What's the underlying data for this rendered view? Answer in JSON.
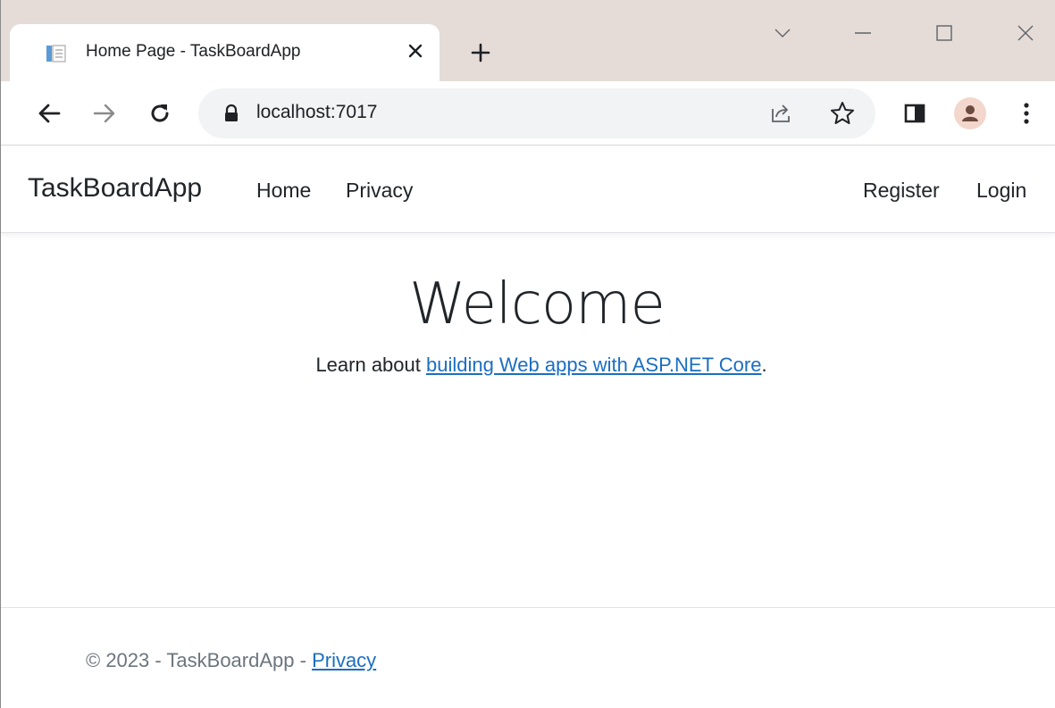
{
  "browser": {
    "tab": {
      "title": "Home Page - TaskBoardApp",
      "favicon": "document-favicon-icon",
      "close_icon": "close-icon"
    },
    "new_tab_icon": "plus-icon",
    "window_controls": [
      "chevron-down-icon",
      "minimize-icon",
      "maximize-icon",
      "close-icon"
    ],
    "toolbar": {
      "back_icon": "arrow-left-icon",
      "forward_icon": "arrow-right-icon",
      "reload_icon": "reload-icon",
      "url": "localhost:7017",
      "lock_icon": "lock-icon",
      "share_icon": "share-icon",
      "bookmark_icon": "star-icon",
      "sidepanel_icon": "side-panel-icon",
      "profile_icon": "avatar-icon",
      "menu_icon": "kebab-menu-icon"
    },
    "colors": {
      "tabstrip": "#e5dcd8",
      "omnibox": "#f1f3f4",
      "link": "#1b6ec2"
    }
  },
  "site": {
    "brand": "TaskBoardApp",
    "nav_left": [
      "Home",
      "Privacy"
    ],
    "nav_right": [
      "Register",
      "Login"
    ],
    "heading": "Welcome",
    "learn_prefix": "Learn about ",
    "learn_link": "building Web apps with ASP.NET Core",
    "learn_suffix": ".",
    "footer_prefix": "© 2023 - TaskBoardApp - ",
    "footer_link": "Privacy"
  }
}
